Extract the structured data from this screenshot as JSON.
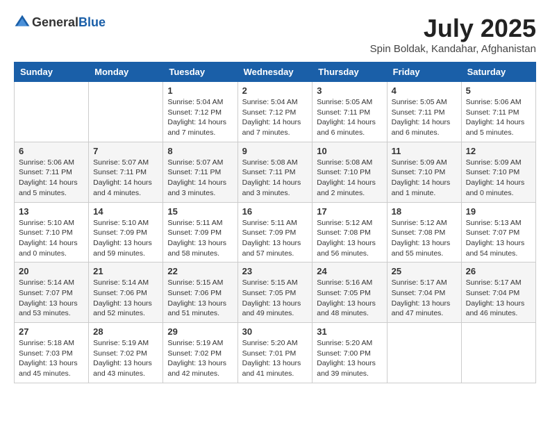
{
  "header": {
    "logo_general": "General",
    "logo_blue": "Blue",
    "month_year": "July 2025",
    "location": "Spin Boldak, Kandahar, Afghanistan"
  },
  "weekdays": [
    "Sunday",
    "Monday",
    "Tuesday",
    "Wednesday",
    "Thursday",
    "Friday",
    "Saturday"
  ],
  "weeks": [
    [
      {
        "day": "",
        "info": ""
      },
      {
        "day": "",
        "info": ""
      },
      {
        "day": "1",
        "info": "Sunrise: 5:04 AM\nSunset: 7:12 PM\nDaylight: 14 hours and 7 minutes."
      },
      {
        "day": "2",
        "info": "Sunrise: 5:04 AM\nSunset: 7:12 PM\nDaylight: 14 hours and 7 minutes."
      },
      {
        "day": "3",
        "info": "Sunrise: 5:05 AM\nSunset: 7:11 PM\nDaylight: 14 hours and 6 minutes."
      },
      {
        "day": "4",
        "info": "Sunrise: 5:05 AM\nSunset: 7:11 PM\nDaylight: 14 hours and 6 minutes."
      },
      {
        "day": "5",
        "info": "Sunrise: 5:06 AM\nSunset: 7:11 PM\nDaylight: 14 hours and 5 minutes."
      }
    ],
    [
      {
        "day": "6",
        "info": "Sunrise: 5:06 AM\nSunset: 7:11 PM\nDaylight: 14 hours and 5 minutes."
      },
      {
        "day": "7",
        "info": "Sunrise: 5:07 AM\nSunset: 7:11 PM\nDaylight: 14 hours and 4 minutes."
      },
      {
        "day": "8",
        "info": "Sunrise: 5:07 AM\nSunset: 7:11 PM\nDaylight: 14 hours and 3 minutes."
      },
      {
        "day": "9",
        "info": "Sunrise: 5:08 AM\nSunset: 7:11 PM\nDaylight: 14 hours and 3 minutes."
      },
      {
        "day": "10",
        "info": "Sunrise: 5:08 AM\nSunset: 7:10 PM\nDaylight: 14 hours and 2 minutes."
      },
      {
        "day": "11",
        "info": "Sunrise: 5:09 AM\nSunset: 7:10 PM\nDaylight: 14 hours and 1 minute."
      },
      {
        "day": "12",
        "info": "Sunrise: 5:09 AM\nSunset: 7:10 PM\nDaylight: 14 hours and 0 minutes."
      }
    ],
    [
      {
        "day": "13",
        "info": "Sunrise: 5:10 AM\nSunset: 7:10 PM\nDaylight: 14 hours and 0 minutes."
      },
      {
        "day": "14",
        "info": "Sunrise: 5:10 AM\nSunset: 7:09 PM\nDaylight: 13 hours and 59 minutes."
      },
      {
        "day": "15",
        "info": "Sunrise: 5:11 AM\nSunset: 7:09 PM\nDaylight: 13 hours and 58 minutes."
      },
      {
        "day": "16",
        "info": "Sunrise: 5:11 AM\nSunset: 7:09 PM\nDaylight: 13 hours and 57 minutes."
      },
      {
        "day": "17",
        "info": "Sunrise: 5:12 AM\nSunset: 7:08 PM\nDaylight: 13 hours and 56 minutes."
      },
      {
        "day": "18",
        "info": "Sunrise: 5:12 AM\nSunset: 7:08 PM\nDaylight: 13 hours and 55 minutes."
      },
      {
        "day": "19",
        "info": "Sunrise: 5:13 AM\nSunset: 7:07 PM\nDaylight: 13 hours and 54 minutes."
      }
    ],
    [
      {
        "day": "20",
        "info": "Sunrise: 5:14 AM\nSunset: 7:07 PM\nDaylight: 13 hours and 53 minutes."
      },
      {
        "day": "21",
        "info": "Sunrise: 5:14 AM\nSunset: 7:06 PM\nDaylight: 13 hours and 52 minutes."
      },
      {
        "day": "22",
        "info": "Sunrise: 5:15 AM\nSunset: 7:06 PM\nDaylight: 13 hours and 51 minutes."
      },
      {
        "day": "23",
        "info": "Sunrise: 5:15 AM\nSunset: 7:05 PM\nDaylight: 13 hours and 49 minutes."
      },
      {
        "day": "24",
        "info": "Sunrise: 5:16 AM\nSunset: 7:05 PM\nDaylight: 13 hours and 48 minutes."
      },
      {
        "day": "25",
        "info": "Sunrise: 5:17 AM\nSunset: 7:04 PM\nDaylight: 13 hours and 47 minutes."
      },
      {
        "day": "26",
        "info": "Sunrise: 5:17 AM\nSunset: 7:04 PM\nDaylight: 13 hours and 46 minutes."
      }
    ],
    [
      {
        "day": "27",
        "info": "Sunrise: 5:18 AM\nSunset: 7:03 PM\nDaylight: 13 hours and 45 minutes."
      },
      {
        "day": "28",
        "info": "Sunrise: 5:19 AM\nSunset: 7:02 PM\nDaylight: 13 hours and 43 minutes."
      },
      {
        "day": "29",
        "info": "Sunrise: 5:19 AM\nSunset: 7:02 PM\nDaylight: 13 hours and 42 minutes."
      },
      {
        "day": "30",
        "info": "Sunrise: 5:20 AM\nSunset: 7:01 PM\nDaylight: 13 hours and 41 minutes."
      },
      {
        "day": "31",
        "info": "Sunrise: 5:20 AM\nSunset: 7:00 PM\nDaylight: 13 hours and 39 minutes."
      },
      {
        "day": "",
        "info": ""
      },
      {
        "day": "",
        "info": ""
      }
    ]
  ]
}
